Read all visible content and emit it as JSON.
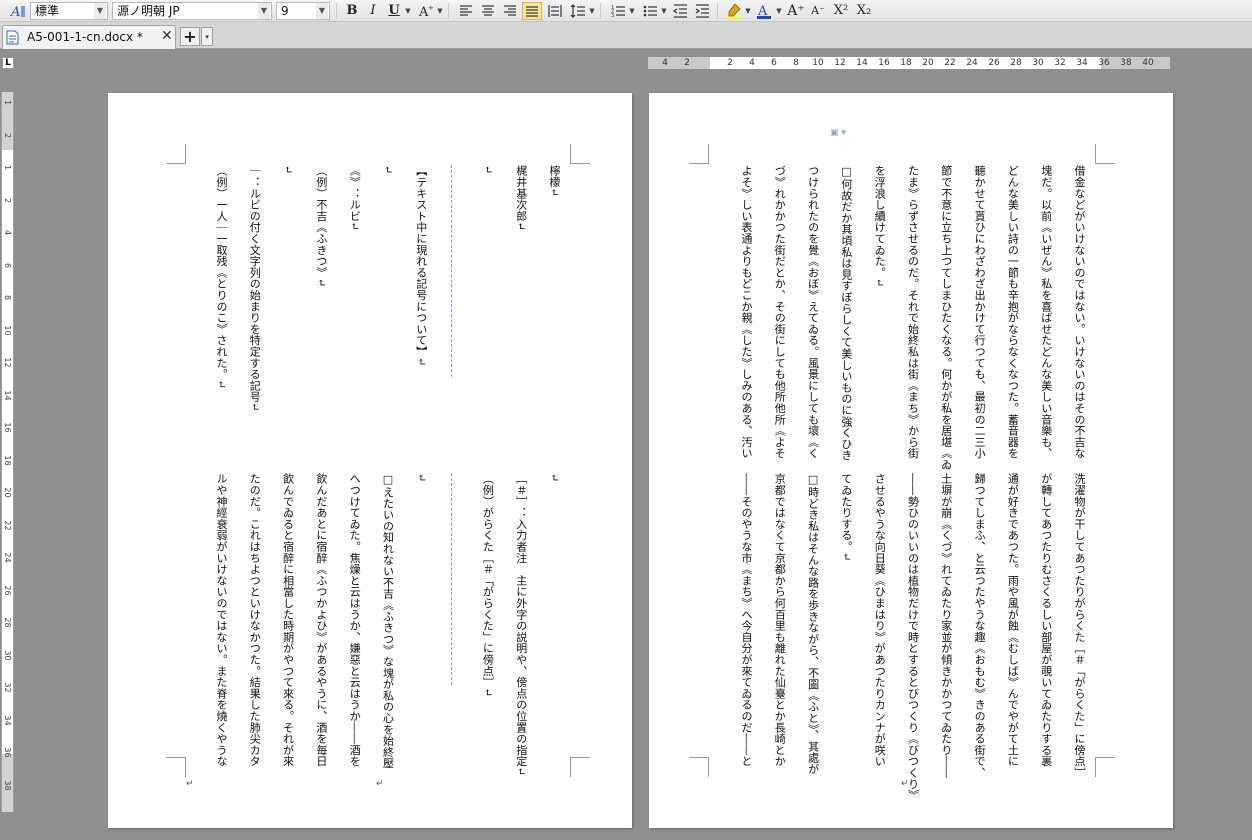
{
  "toolbar": {
    "style_value": "標準",
    "font_value": "源ノ明朝 JP",
    "size_value": "9",
    "bold": "B",
    "italic": "I",
    "underline": "U",
    "superscript": "X²",
    "subscript": "X₂",
    "grow_font": "A⁺",
    "shrink_font": "A⁻"
  },
  "tab": {
    "title": "A5-001-1-cn.docx *",
    "close": "✕",
    "new": "+",
    "menu": "▾"
  },
  "ruler": {
    "corner": "L",
    "h_ticks": [
      "4",
      "2",
      "2",
      "4",
      "6",
      "8",
      "10",
      "12",
      "14",
      "16",
      "18",
      "20",
      "22",
      "24",
      "26",
      "28",
      "30",
      "32",
      "34",
      "36",
      "38",
      "40"
    ],
    "v_ticks": [
      "1",
      "2",
      "1",
      "2",
      "4",
      "6",
      "8",
      "10",
      "12",
      "14",
      "16",
      "18",
      "20",
      "22",
      "24",
      "26",
      "28",
      "30",
      "32",
      "34",
      "36",
      "38"
    ]
  },
  "left_page": {
    "top_lines": [
      "檸檬↵",
      "梶井基次郎↵",
      "↵",
      "",
      "【テキスト中に現れる記号について】↵",
      "↵",
      "《》：ルビ↵",
      "（例）不吉《ふきつ》↵",
      "↵",
      "｜：ルビの付く文字列の始まりを特定する記号↵",
      "（例）一人｜一取残《とりのこ》された。↵"
    ],
    "bottom_lines": [
      "↵",
      "［＃］：入力者注　主に外字の説明や、傍点の位置の指定↵",
      "（例）がらくた［＃「がらくた」に傍点］↵",
      "",
      "↵",
      "□えたいの知れない不吉《ふきつ》な塊が私の心を始終壓",
      "へつけてゐた。焦燥と云はうか、嫌惡と云はうか――酒を",
      "飲んだあとに宿醉《ふつかよひ》があるやうに、酒を毎日",
      "飲んでゐると宿醉に相當した時期がやつて來る。それが來",
      "たのだ。これはちよつといけなかつた。結果した肺尖カタ",
      "ルや神經衰弱がいけないのではない。また脊を燒くやうな"
    ]
  },
  "right_page": {
    "top_lines": [
      "借金などがいけないのではない。いけないのはその不吉な",
      "塊だ。以前《いぜん》私を喜ばせたどんな美しい音樂も、",
      "どんな美しい詩の一節も辛抱がならなくなつた。蓄音器を",
      "聽かせて貰ひにわざわざ出かけて行つても、最初の二三小",
      "節で不意に立ち上つてしまひたくなる。何かが私を居堪《ゐ",
      "たま》らずさせるのだ。それで始終私は街《まち》から街",
      "を浮浪し續けてゐた。↵",
      "□何故だか其頃私は見すぼらしくて美しいものに強くひき",
      "つけられたのを覺《おぼ》えてゐる。風景にしても壞《く",
      "づ》れかかつた街だとか、その街にしても他所他所《よそ",
      "よそ》しい表通よりもどこか親《した》しみのある、汚い"
    ],
    "bottom_lines": [
      "洗濯物が干してあつたりがらくた［＃「がらくた」に傍点］",
      "が轉してあつたりむさくるしい部屋が覗いてゐたりする裏",
      "通が好きであつた。雨や風が蝕《むしば》んでやがて土に",
      "歸つてしまふ、と云つたやうな趣《おもむ》きのある街で、",
      "土塀が崩《くづ》れてゐたり家並が傾きかかつてゐたり――",
      "――勢ひのいいのは植物だけで時とするとびつくり《びつくり》",
      "させるやうな向日葵《ひまはり》があつたりカンナが咲い",
      "てゐたりする。↵",
      "□時どき私はそんな路を歩きながら、不圖《ふと》、其處が",
      "京都ではなくて京都から何百里も離れた仙臺とか長崎とか",
      "――そのやうな市《まち》へ今自分が來てゐるのだ――と"
    ]
  }
}
